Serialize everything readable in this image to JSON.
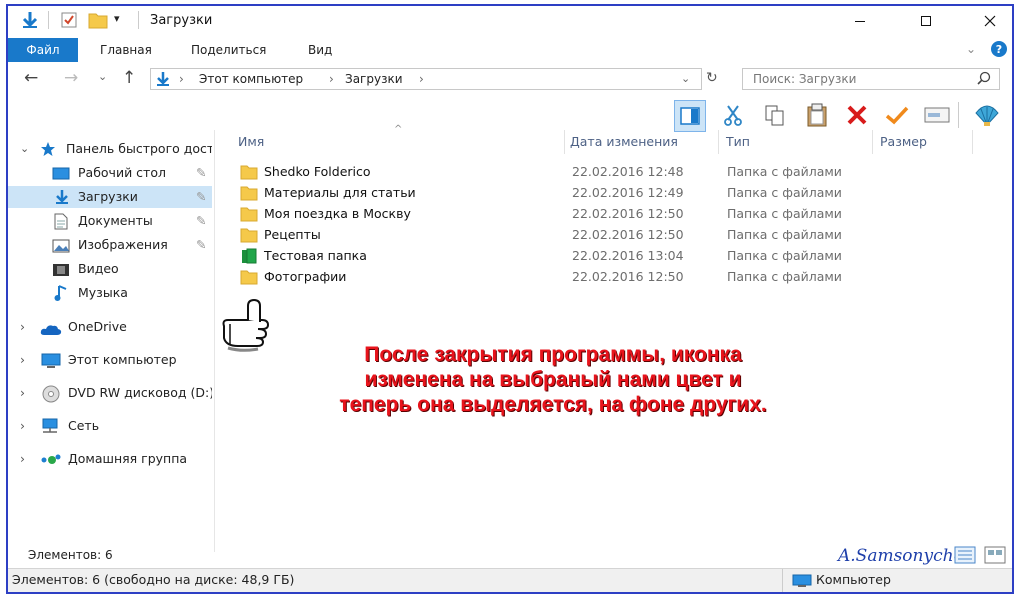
{
  "window": {
    "title": "Загрузки"
  },
  "ribbon": {
    "tabs": [
      "Файл",
      "Главная",
      "Поделиться",
      "Вид"
    ]
  },
  "address": {
    "crumbs": [
      "Этот компьютер",
      "Загрузки"
    ]
  },
  "search": {
    "placeholder": "Поиск: Загрузки"
  },
  "nav": {
    "quick_access": "Панель быстрого доступа",
    "quick_items": [
      "Рабочий стол",
      "Загрузки",
      "Документы",
      "Изображения",
      "Видео",
      "Музыка"
    ],
    "roots": [
      "OneDrive",
      "Этот компьютер",
      "DVD RW дисковод (D:)",
      "Сеть",
      "Домашняя группа"
    ]
  },
  "columns": {
    "name": "Имя",
    "date": "Дата изменения",
    "type": "Тип",
    "size": "Размер"
  },
  "files": [
    {
      "name": "Shedko Folderico",
      "date": "22.02.2016 12:48",
      "type": "Папка с файлами",
      "icon": "folder-icon"
    },
    {
      "name": "Материалы для статьи",
      "date": "22.02.2016 12:49",
      "type": "Папка с файлами",
      "icon": "folder-icon"
    },
    {
      "name": "Моя поездка в Москву",
      "date": "22.02.2016 12:50",
      "type": "Папка с файлами",
      "icon": "folder-icon"
    },
    {
      "name": "Рецепты",
      "date": "22.02.2016 12:50",
      "type": "Папка с файлами",
      "icon": "folder-icon"
    },
    {
      "name": "Тестовая папка",
      "date": "22.02.2016 13:04",
      "type": "Папка с файлами",
      "icon": "green-folder-icon"
    },
    {
      "name": "Фотографии",
      "date": "22.02.2016 12:50",
      "type": "Папка с файлами",
      "icon": "folder-icon"
    }
  ],
  "annotation": {
    "line1": "После закрытия программы, иконка",
    "line2": "изменена на выбраный нами цвет и",
    "line3": "теперь она выделяется, на фоне других."
  },
  "status": {
    "items": "Элементов: 6",
    "bar": "Элементов: 6 (свободно на диске: 48,9 ГБ)",
    "location": "Компьютер"
  },
  "signature": "A.Samsonychev",
  "colors": {
    "accent": "#1979ca",
    "annotation": "#e8141c",
    "frame": "#2d3fc4",
    "folder": "#f5c94a",
    "green_folder": "#21a64a"
  }
}
